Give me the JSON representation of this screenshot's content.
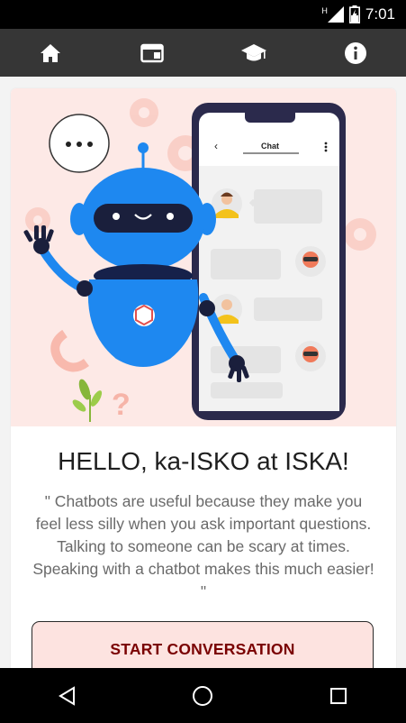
{
  "status_bar": {
    "time": "7:01",
    "network_label": "H"
  },
  "nav": {
    "items": [
      {
        "name": "home",
        "icon": "home-icon"
      },
      {
        "name": "browser",
        "icon": "web-window-icon"
      },
      {
        "name": "education",
        "icon": "graduation-cap-icon"
      },
      {
        "name": "info",
        "icon": "info-icon"
      }
    ]
  },
  "hero": {
    "phone_header": "Chat",
    "back_glyph": "‹",
    "more_glyph": "⋮",
    "speech_bubble": "• • •"
  },
  "card": {
    "title": "HELLO, ka-ISKO at ISKA!",
    "quote": "\" Chatbots are useful because they make you feel less silly when you ask important questions. Talking to someone can be scary at times. Speaking with a chatbot makes this much easier! \"",
    "cta_label": "START CONVERSATION"
  },
  "colors": {
    "nav_bg": "#363636",
    "hero_bg": "#fde9e6",
    "robot_blue": "#1e88f0",
    "phone_frame": "#2b2a4c",
    "cta_text": "#7a0000",
    "cta_bg": "#fde3e0"
  }
}
